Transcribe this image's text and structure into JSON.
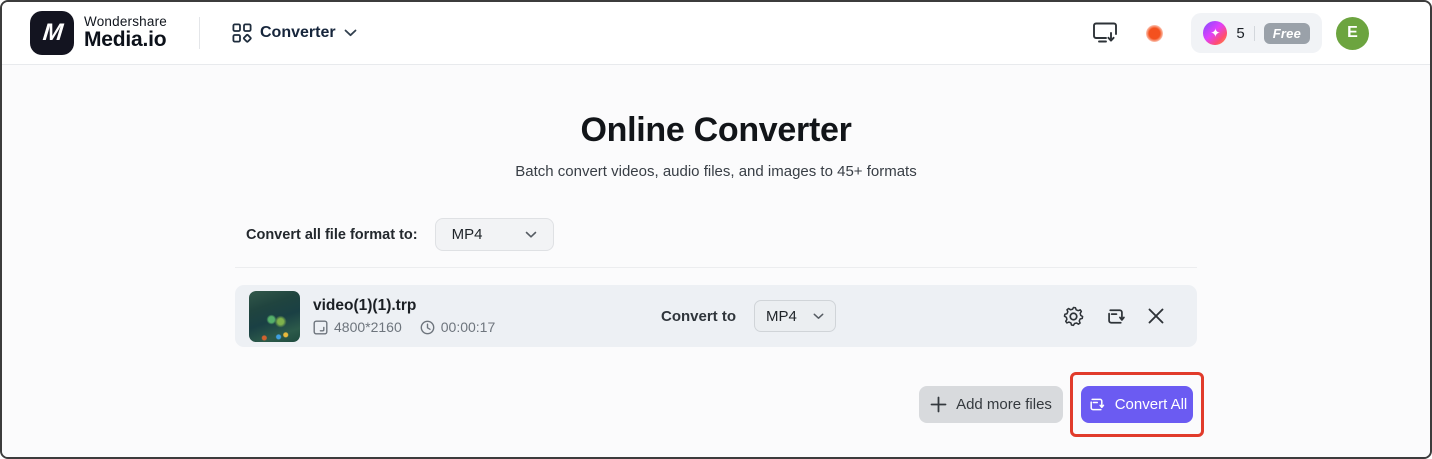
{
  "header": {
    "brand": {
      "logo_letter": "M",
      "line1": "Wondershare",
      "line2": "Media.io"
    },
    "nav_converter": "Converter",
    "credits_count": "5",
    "plan_badge": "Free",
    "avatar_initial": "E"
  },
  "hero": {
    "title": "Online Converter",
    "subtitle": "Batch convert videos, audio files, and images to 45+ formats"
  },
  "format_bar": {
    "label": "Convert all file format to:",
    "value": "MP4"
  },
  "file_row": {
    "name": "video(1)(1).trp",
    "resolution": "4800*2160",
    "duration": "00:00:17",
    "convert_to_label": "Convert to",
    "format_value": "MP4"
  },
  "actions": {
    "add_more": "Add more files",
    "convert_all": "Convert All"
  },
  "icons": {
    "sparkle_glyph": "✦",
    "converter_grid": "grid-with-diamond",
    "monitor_download": "monitor-with-down-arrow",
    "resolution": "frame-corner",
    "duration": "clock",
    "settings": "gear",
    "convert": "repeat-loop",
    "remove": "x-cross",
    "add": "plus"
  },
  "colors": {
    "accent_purple": "#6b5bf2",
    "annotation_red": "#e13b2b",
    "avatar_green": "#6ca43f",
    "card_bg": "#edf0f4"
  }
}
